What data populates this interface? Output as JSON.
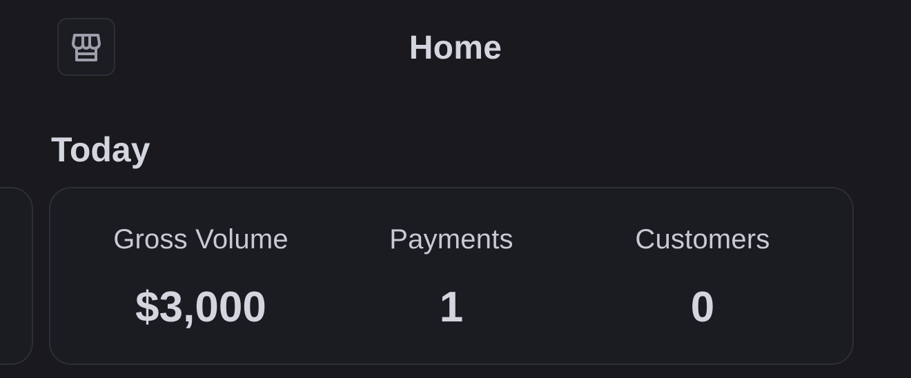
{
  "header": {
    "title": "Home",
    "store_icon": "storefront-icon"
  },
  "section": {
    "title": "Today"
  },
  "stats": [
    {
      "label": "Gross Volume",
      "value": "$3,000"
    },
    {
      "label": "Payments",
      "value": "1"
    },
    {
      "label": "Customers",
      "value": "0"
    }
  ],
  "colors": {
    "background": "#19191e",
    "card": "#1b1c21",
    "border": "#2c2f37",
    "text": "#d3d5df"
  }
}
